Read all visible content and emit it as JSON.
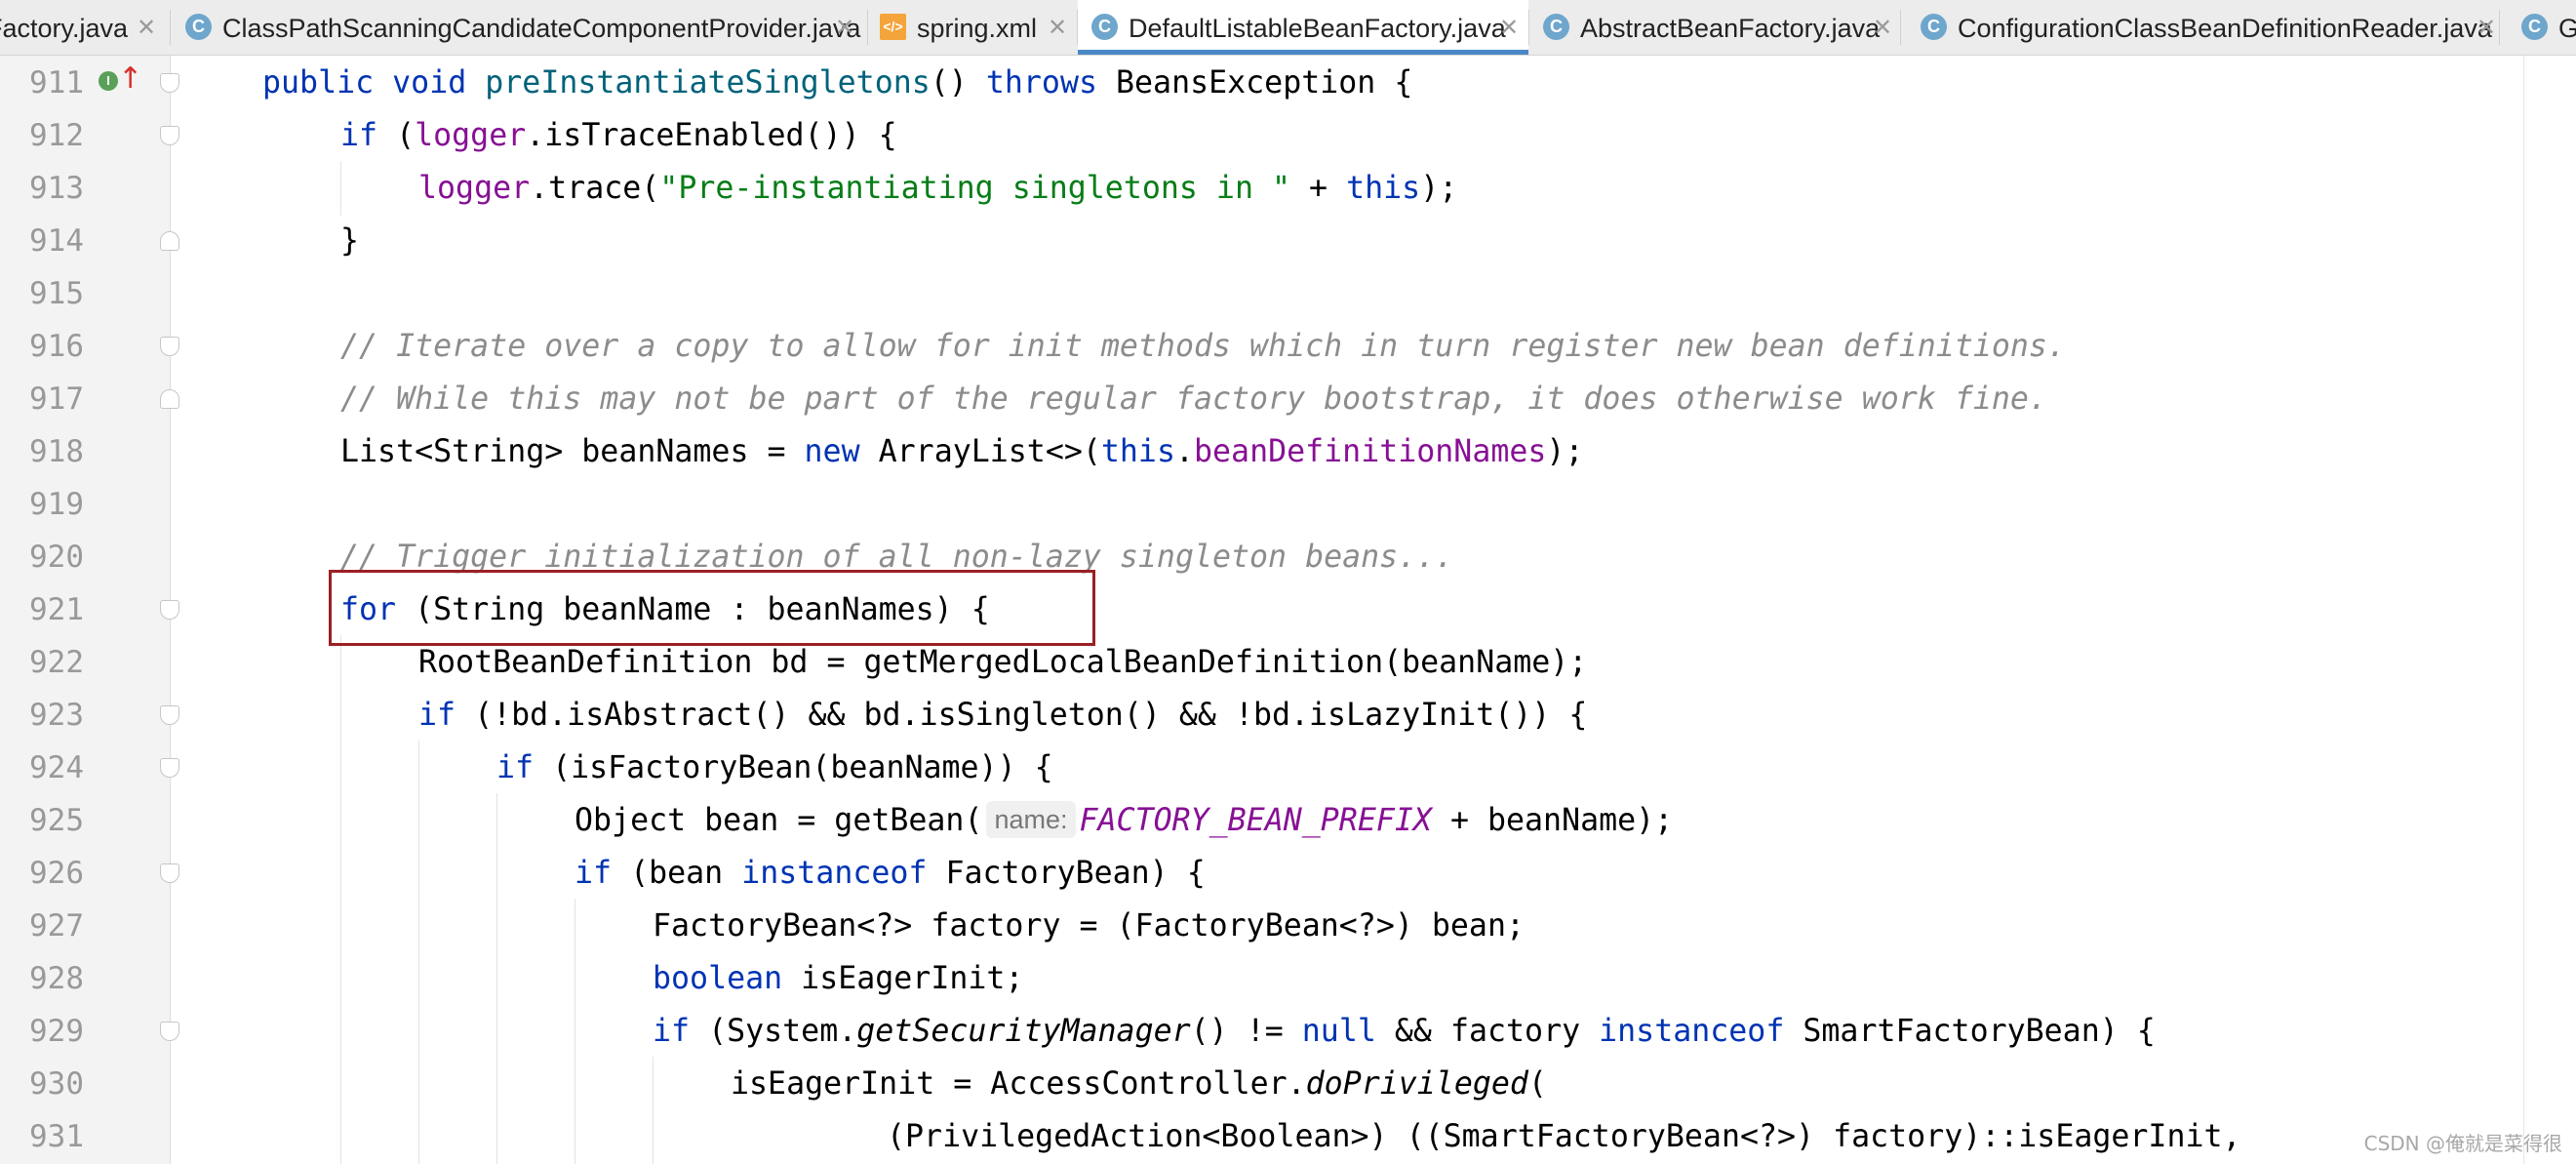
{
  "tabs": [
    {
      "label": "Factory.java",
      "icon": "class-icon",
      "active": false
    },
    {
      "label": "ClassPathScanningCandidateComponentProvider.java",
      "icon": "class-icon",
      "active": false
    },
    {
      "label": "spring.xml",
      "icon": "xml-file-icon",
      "active": false
    },
    {
      "label": "DefaultListableBeanFactory.java",
      "icon": "class-icon",
      "active": true
    },
    {
      "label": "AbstractBeanFactory.java",
      "icon": "class-icon",
      "active": false
    },
    {
      "label": "ConfigurationClassBeanDefinitionReader.java",
      "icon": "class-icon",
      "active": false
    },
    {
      "label": "G",
      "icon": "class-icon",
      "active": false
    }
  ],
  "tab_close_glyph": "✕",
  "class_icon_letter": "C",
  "xml_icon_letter": "</>",
  "gutter": {
    "line_numbers": [
      "911",
      "912",
      "913",
      "914",
      "915",
      "916",
      "917",
      "918",
      "919",
      "920",
      "921",
      "922",
      "923",
      "924",
      "925",
      "926",
      "927",
      "928",
      "929",
      "930",
      "931"
    ],
    "implements_icon_letter": "I",
    "override_arrow": "↑"
  },
  "code": {
    "l911": {
      "kw1": "public void ",
      "method": "preInstantiateSingletons",
      "p1": "() ",
      "kw2": "throws ",
      "rest": "BeansException {"
    },
    "l912": {
      "kw1": "if ",
      "p1": "(",
      "field": "logger",
      "rest": ".isTraceEnabled()) {"
    },
    "l913": {
      "field": "logger",
      "p1": ".trace(",
      "str": "\"Pre-instantiating singletons in \"",
      "p2": " + ",
      "kw1": "this",
      "rest": ");"
    },
    "l914": {
      "rest": "}"
    },
    "l916": {
      "comment": "// Iterate over a copy to allow for init methods which in turn register new bean definitions."
    },
    "l917": {
      "comment": "// While this may not be part of the regular factory bootstrap, it does otherwise work fine."
    },
    "l918": {
      "p1": "List<String> beanNames = ",
      "kw1": "new ",
      "p2": "ArrayList<>(",
      "kw2": "this",
      "p3": ".",
      "field": "beanDefinitionNames",
      "rest": ");"
    },
    "l920": {
      "comment": "// Trigger initialization of all non-lazy singleton beans..."
    },
    "l921": {
      "kw1": "for ",
      "rest": "(String beanName : beanNames) {"
    },
    "l922": {
      "rest": "RootBeanDefinition bd = getMergedLocalBeanDefinition(beanName);"
    },
    "l923": {
      "kw1": "if ",
      "rest": "(!bd.isAbstract() && bd.isSingleton() && !bd.isLazyInit()) {"
    },
    "l924": {
      "kw1": "if ",
      "rest": "(isFactoryBean(beanName)) {"
    },
    "l925": {
      "p1": "Object bean = getBean(",
      "hint": "name:",
      "const": "FACTORY_BEAN_PREFIX",
      "rest": " + beanName);"
    },
    "l926": {
      "kw1": "if ",
      "p1": "(bean ",
      "kw2": "instanceof ",
      "rest": "FactoryBean) {"
    },
    "l927": {
      "rest": "FactoryBean<?> factory = (FactoryBean<?>) bean;"
    },
    "l928": {
      "kw1": "boolean ",
      "rest": "isEagerInit;"
    },
    "l929": {
      "kw1": "if ",
      "p1": "(System.",
      "static": "getSecurityManager",
      "p2": "() != ",
      "kw2": "null",
      "p3": " && factory ",
      "kw3": "instanceof ",
      "rest": "SmartFactoryBean) {"
    },
    "l930": {
      "p1": "isEagerInit = AccessController.",
      "static": "doPrivileged",
      "rest": "("
    },
    "l931": {
      "rest": "(PrivilegedAction<Boolean>) ((SmartFactoryBean<?>) factory)::isEagerInit,"
    }
  },
  "watermark": "CSDN @俺就是菜得很",
  "colors": {
    "keyword": "#0033b3",
    "method": "#00627a",
    "field": "#871094",
    "string": "#067d17",
    "comment": "#8c8c8c",
    "highlight_box": "#9b1f24",
    "active_tab_underline": "#4a88c7"
  }
}
